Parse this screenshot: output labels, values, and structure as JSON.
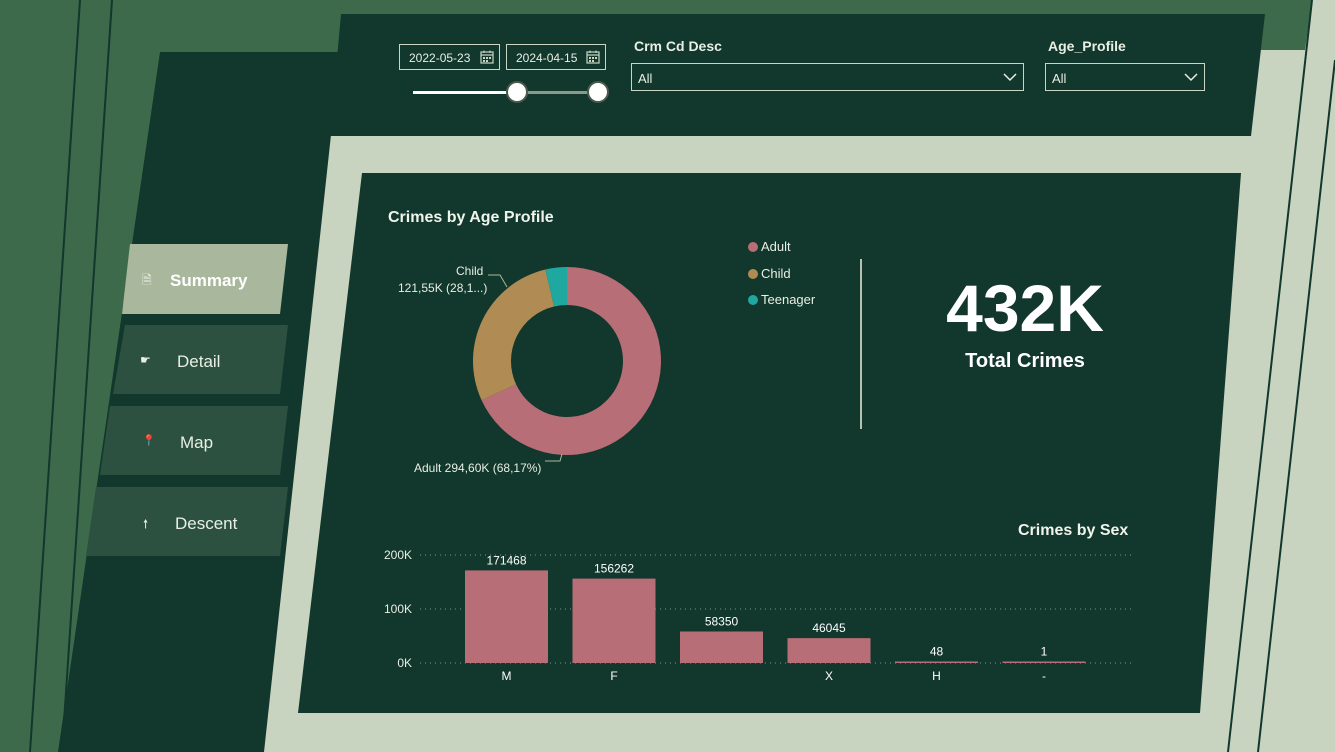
{
  "filters": {
    "start_date": "2022-05-23",
    "end_date": "2024-04-15",
    "date_range_position": [
      0.56,
      1.0
    ],
    "crime_desc": {
      "title": "Crm Cd Desc",
      "selected": "All"
    },
    "age_profile": {
      "title": "Age_Profile",
      "selected": "All"
    }
  },
  "nav": {
    "items": [
      {
        "label": "Summary",
        "icon": "document-icon",
        "glyph": "🗎",
        "active": true
      },
      {
        "label": "Detail",
        "icon": "pointing-hand-icon",
        "glyph": "☛",
        "active": false
      },
      {
        "label": "Map",
        "icon": "pushpin-icon",
        "glyph": "📍",
        "active": false
      },
      {
        "label": "Descent",
        "icon": "person-icon",
        "glyph": "🠕",
        "active": false
      }
    ]
  },
  "donut": {
    "title": "Crimes by Age Profile",
    "legend": [
      "Adult",
      "Child",
      "Teenager"
    ],
    "labels": {
      "child_name": "Child",
      "child_value": "121,55K (28,1...)",
      "adult": "Adult 294,60K (68,17%)"
    }
  },
  "kpi": {
    "value": "432K",
    "label": "Total Crimes"
  },
  "bar": {
    "title": "Crimes by Sex",
    "ytick_labels": [
      "200K",
      "100K",
      "0K"
    ]
  },
  "colors": {
    "adult": "#b86e77",
    "child": "#b08c54",
    "teenager": "#1fa8a0",
    "panel": "#12372c",
    "frame": "#c8d3c0",
    "accent_green": "#3e6a4c"
  },
  "chart_data": [
    {
      "type": "pie",
      "title": "Crimes by Age Profile",
      "categories": [
        "Adult",
        "Child",
        "Teenager"
      ],
      "values": [
        294600,
        121550,
        15981
      ]
    },
    {
      "type": "bar",
      "title": "Crimes by Sex",
      "categories": [
        "M",
        "F",
        "",
        "X",
        "H",
        "-"
      ],
      "values": [
        171468,
        156262,
        58350,
        46045,
        48,
        1
      ],
      "ylim": [
        0,
        200000
      ],
      "yticks": [
        0,
        100000,
        200000
      ],
      "grid": true
    }
  ]
}
